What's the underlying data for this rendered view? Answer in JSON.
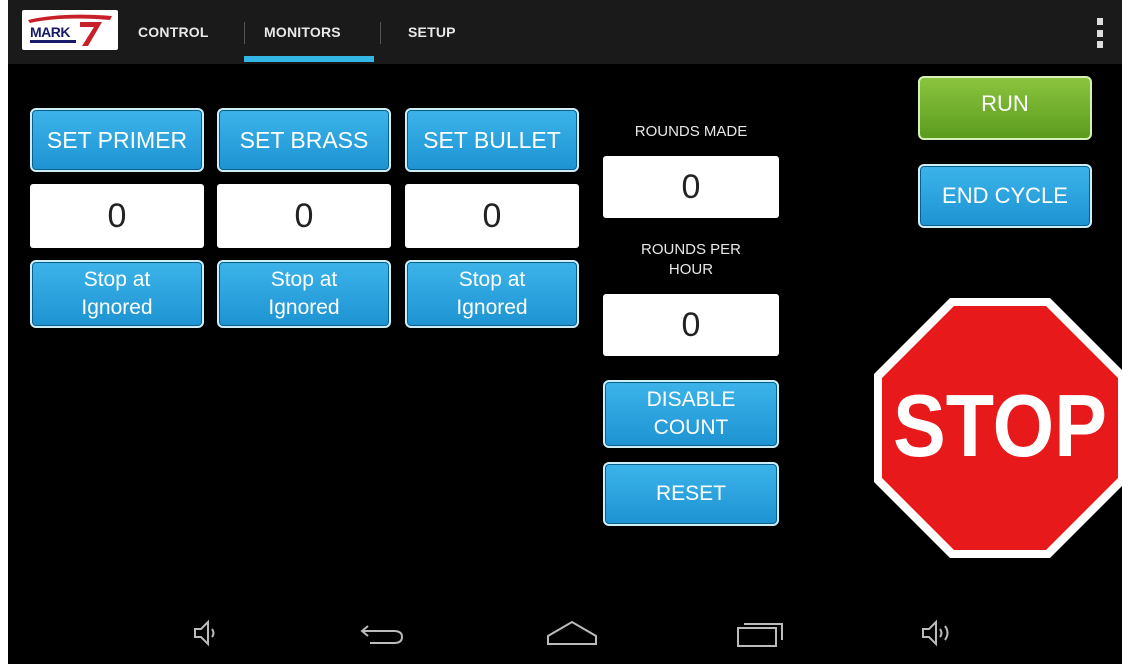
{
  "app": {
    "logo_text": "MARK7"
  },
  "tabs": [
    {
      "label": "CONTROL",
      "selected": false
    },
    {
      "label": "MONITORS",
      "selected": true
    },
    {
      "label": "SETUP",
      "selected": false
    }
  ],
  "monitors": {
    "columns": [
      {
        "set_label": "SET PRIMER",
        "value": "0",
        "stop_line1": "Stop at",
        "stop_line2": "Ignored"
      },
      {
        "set_label": "SET BRASS",
        "value": "0",
        "stop_line1": "Stop at",
        "stop_line2": "Ignored"
      },
      {
        "set_label": "SET BULLET",
        "value": "0",
        "stop_line1": "Stop at",
        "stop_line2": "Ignored"
      }
    ],
    "rounds_made_label": "ROUNDS MADE",
    "rounds_made_value": "0",
    "rounds_per_hour_line1": "ROUNDS PER",
    "rounds_per_hour_line2": "HOUR",
    "rounds_per_hour_value": "0",
    "disable_count_line1": "DISABLE",
    "disable_count_line2": "COUNT",
    "reset_label": "RESET"
  },
  "controls": {
    "run_label": "RUN",
    "end_cycle_label": "END CYCLE",
    "stop_label": "STOP"
  },
  "navbar": {
    "icons": [
      "volume-down-icon",
      "back-icon",
      "home-icon",
      "recent-apps-icon",
      "volume-up-icon"
    ]
  },
  "colors": {
    "accent_blue": "#33b5e5",
    "button_blue": "#1d93d2",
    "run_green": "#5b9b1d",
    "stop_red": "#e8191b"
  }
}
